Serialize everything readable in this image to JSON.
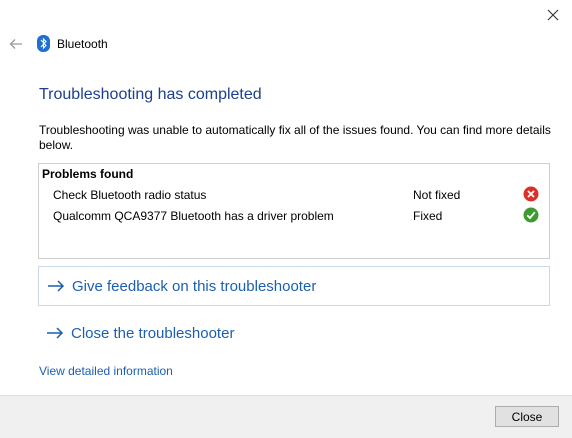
{
  "window": {
    "close_icon": "close-icon",
    "back_icon": "back-arrow-icon"
  },
  "header": {
    "app_icon": "bluetooth-icon",
    "app_title": "Bluetooth"
  },
  "main": {
    "title": "Troubleshooting has completed",
    "description": "Troubleshooting was unable to automatically fix all of the issues found. You can find more details below."
  },
  "problems": {
    "heading": "Problems found",
    "items": [
      {
        "name": "Check Bluetooth radio status",
        "status": "Not fixed",
        "icon": "error-icon"
      },
      {
        "name": "Qualcomm QCA9377 Bluetooth has a driver problem",
        "status": "Fixed",
        "icon": "check-icon"
      }
    ]
  },
  "links": {
    "feedback": "Give feedback on this troubleshooter",
    "close_troubleshooter": "Close the troubleshooter",
    "view_details": "View detailed information"
  },
  "footer": {
    "close_label": "Close"
  },
  "colors": {
    "title": "#1c3f8f",
    "link": "#1c5fb0",
    "error": "#d9312a",
    "success": "#3f9a2f"
  }
}
